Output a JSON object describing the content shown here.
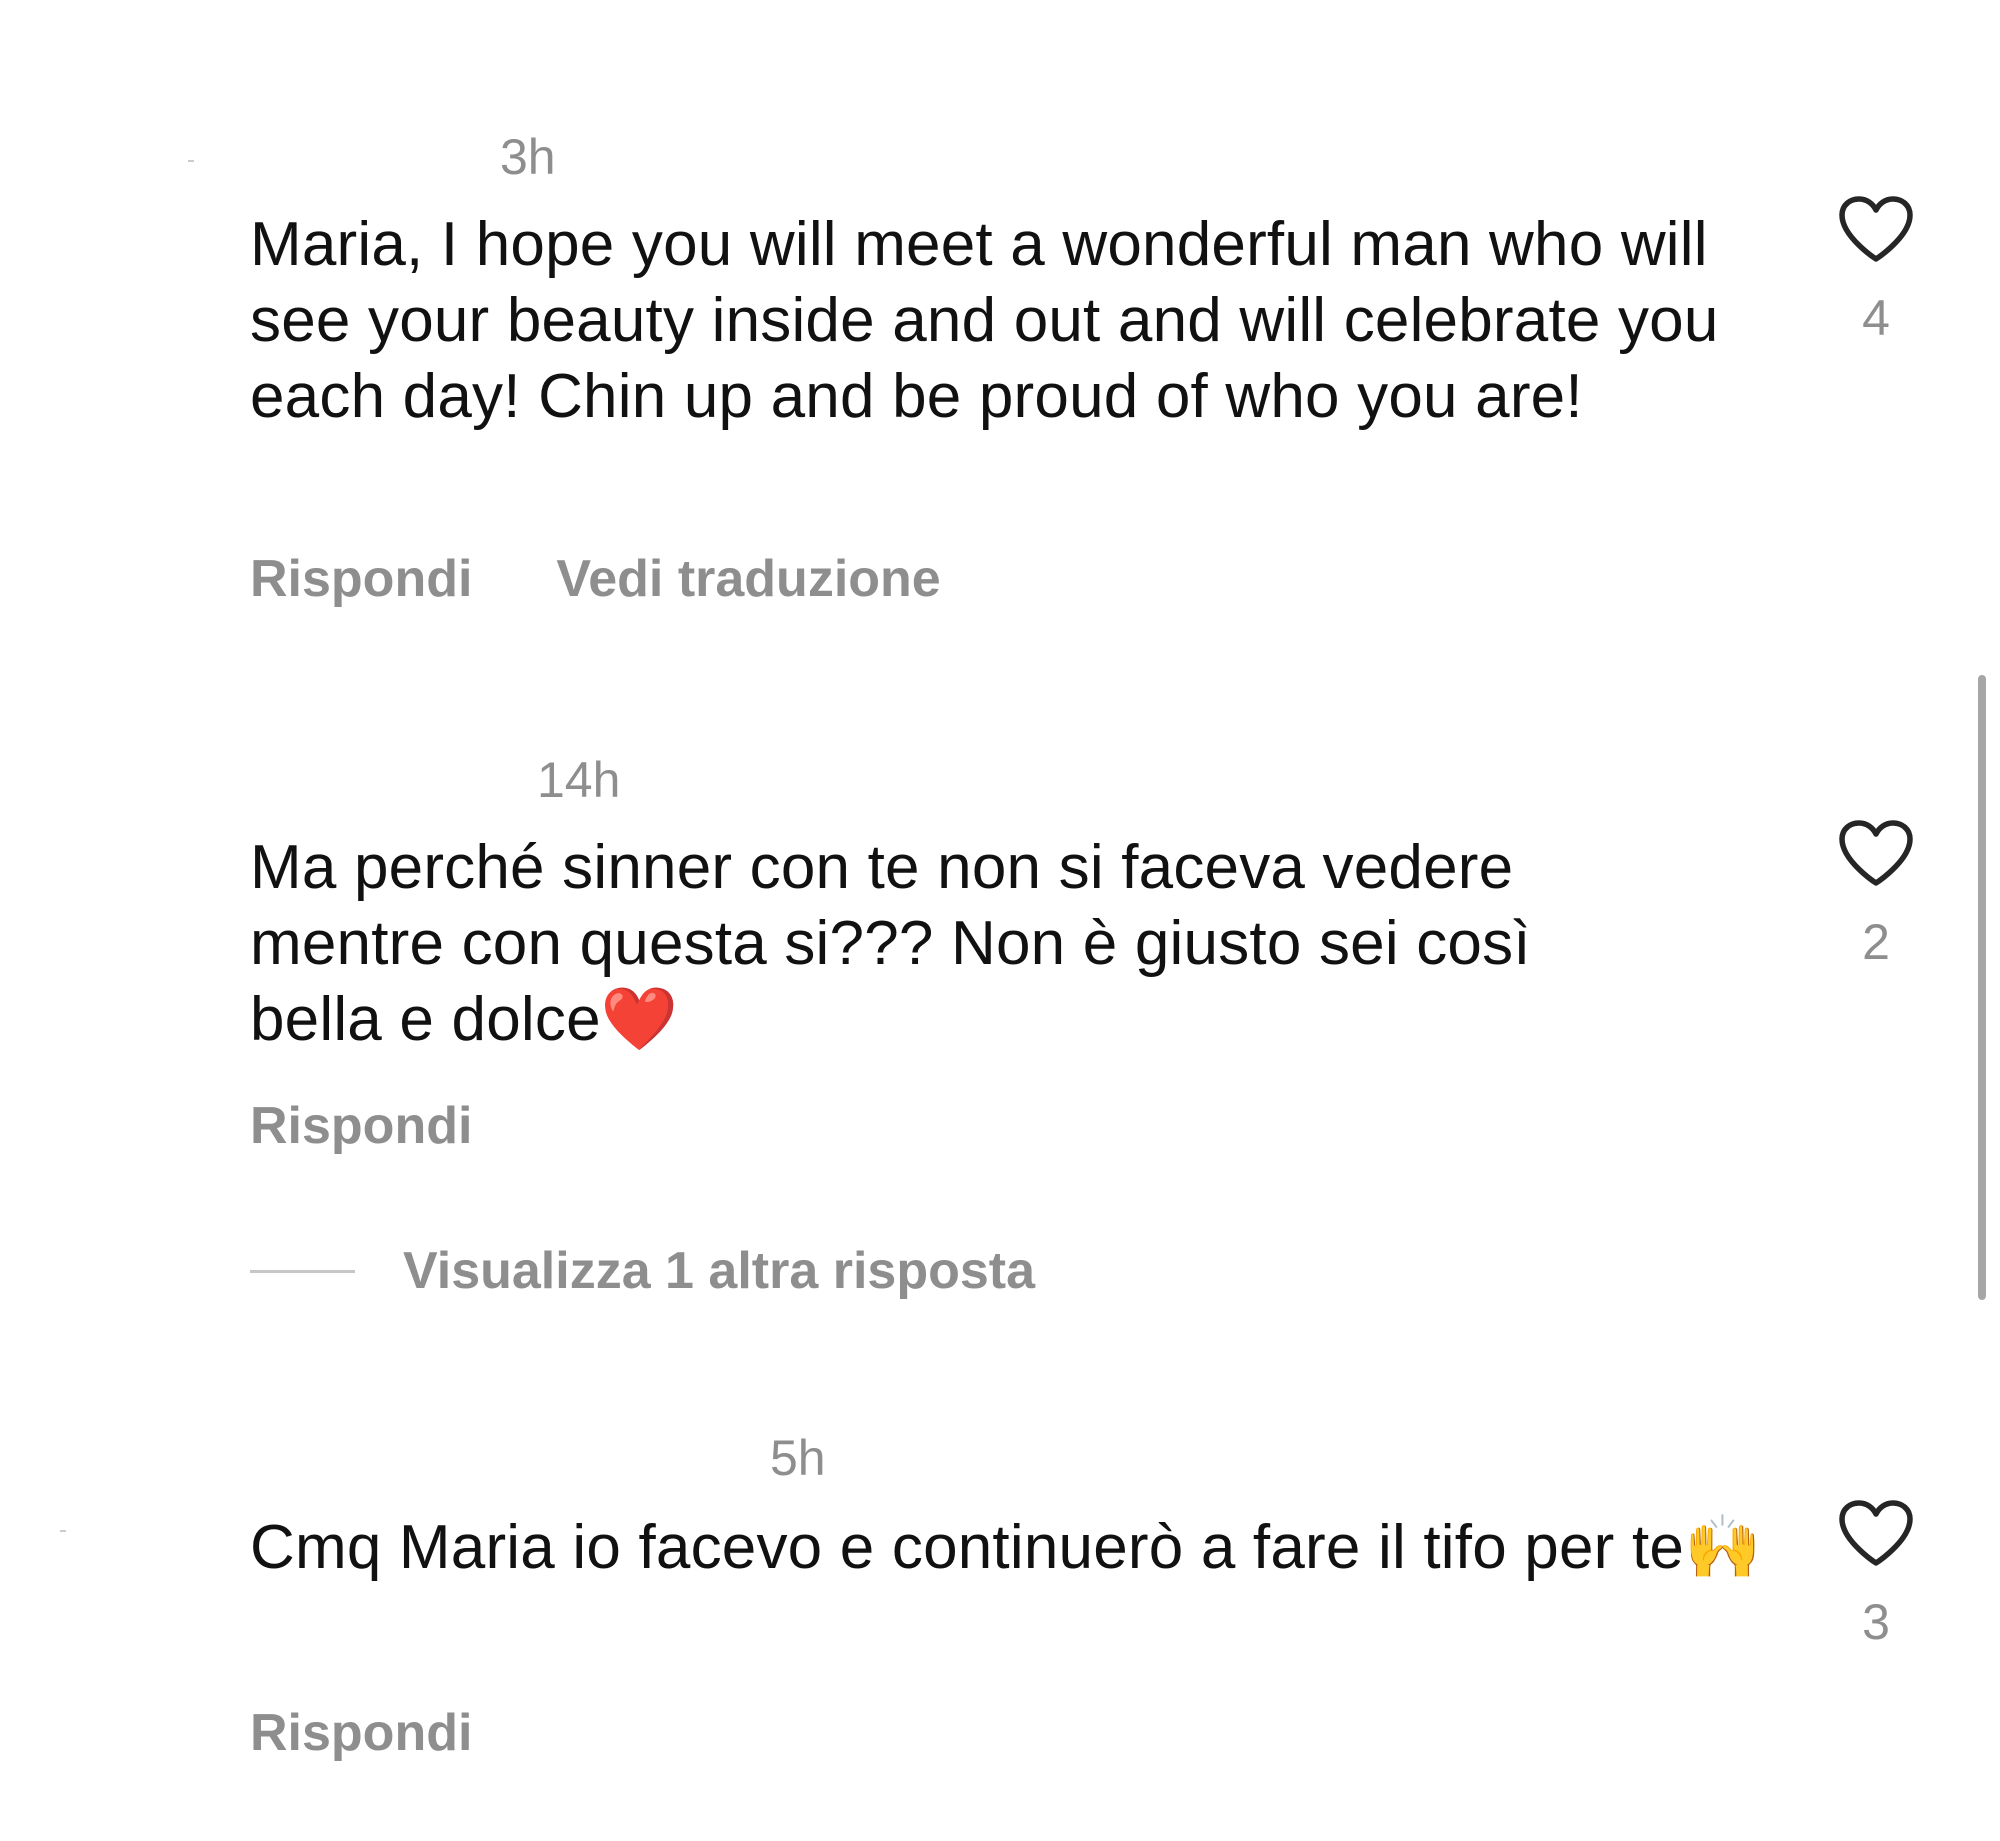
{
  "comments": [
    {
      "time": "3h",
      "text": "Maria, I hope you will meet a wonderful man who will see your beauty inside and out and will celebrate you each day! Chin up and be proud of who you are!",
      "reply_label": "Rispondi",
      "translate_label": "Vedi traduzione",
      "likes": "4"
    },
    {
      "time": "14h",
      "text": "Ma perché sinner con te non si faceva vedere mentre con questa si??? Non è giusto sei così bella e dolce❤️",
      "reply_label": "Rispondi",
      "likes": "2",
      "view_replies_label": "Visualizza 1 altra risposta"
    },
    {
      "time": "5h",
      "text": "Cmq Maria io facevo e continuerò a fare il tifo per te🙌",
      "reply_label": "Rispondi",
      "likes": "3"
    }
  ],
  "icons": {
    "like": "heart-outline-icon"
  },
  "colors": {
    "text": "#111111",
    "secondary": "#8e8e8e",
    "background": "#ffffff"
  }
}
